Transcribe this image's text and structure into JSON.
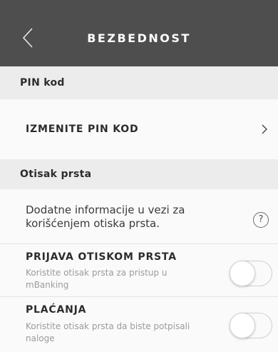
{
  "header": {
    "title": "BEZBEDNOST",
    "back_icon": "chevron-left-icon",
    "background": "#4e4e4e"
  },
  "sections": {
    "pin": {
      "header": "PIN kod",
      "change_pin_label": "IZMENITE PIN KOD",
      "chevron_icon": "chevron-right-icon"
    },
    "fingerprint": {
      "header": "Otisak prsta",
      "info_text": "Dodatne informacije u vezi za korišćenjem otiska prsta.",
      "help_icon": "?",
      "login": {
        "title": "PRIJAVA OTISKOM PRSTA",
        "subtitle": "Koristite otisak prsta za pristup u mBanking",
        "enabled": false
      },
      "payments": {
        "title": "PLAĆANJA",
        "subtitle": "Koristite otisak prsta da biste potpisali naloge",
        "enabled": false
      }
    }
  }
}
